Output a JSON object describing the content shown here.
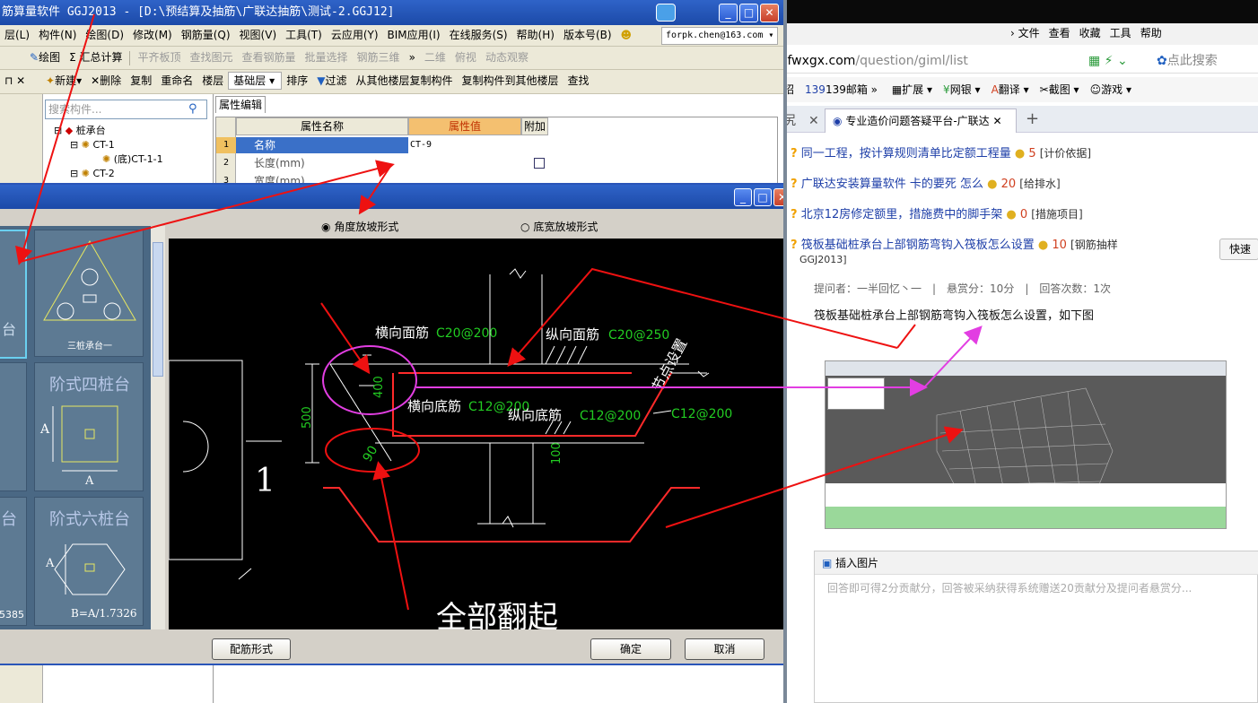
{
  "app": {
    "title": "筋算量软件 GGJ2013 - [D:\\预结算及抽筋\\广联达抽筋\\测试-2.GGJ12]",
    "menu": [
      "层(L)",
      "构件(N)",
      "绘图(D)",
      "修改(M)",
      "钢筋量(Q)",
      "视图(V)",
      "工具(T)",
      "云应用(Y)",
      "BIM应用(I)",
      "在线服务(S)",
      "帮助(H)",
      "版本号(B)"
    ],
    "account": "forpk.chen@163.com",
    "toolbar1": [
      "绘图",
      "Σ 汇总计算",
      "平齐板顶",
      "查找图元",
      "查看钢筋量",
      "批量选择",
      "钢筋三维",
      "二维",
      "俯视",
      "动态观察"
    ],
    "toolbar2": {
      "new": "新建",
      "delete": "删除",
      "copy": "复制",
      "rename": "重命名",
      "floor_label": "楼层",
      "floor_value": "基础层",
      "sort": "排序",
      "filter": "过滤",
      "copy_from": "从其他楼层复制构件",
      "copy_to": "复制构件到其他楼层",
      "find": "查找"
    },
    "search_placeholder": "搜索构件...",
    "tree": [
      "桩承台",
      "CT-1",
      "(底)CT-1-1",
      "CT-2"
    ],
    "prop_tab": "属性编辑",
    "prop_headers": [
      "属性名称",
      "属性值",
      "附加"
    ],
    "prop_rows": [
      {
        "no": "1",
        "name": "名称",
        "value": "CT-9"
      },
      {
        "no": "2",
        "name": "长度(mm)",
        "value": ""
      },
      {
        "no": "3",
        "name": "宽度(mm)",
        "value": ""
      }
    ]
  },
  "dialog": {
    "radio_angle": "角度放坡形式",
    "radio_width": "底宽放坡形式",
    "tiles": [
      "三桩承台一",
      "阶式四桩台",
      "阶式六桩台"
    ],
    "tile_texts": {
      "a": "A",
      "b": "B=A/1.7326",
      "left_partial_1": "台",
      "left_partial_2": "台",
      "left_partial_num": "5385"
    },
    "buttons": {
      "rebar_form": "配筋形式",
      "ok": "确定",
      "cancel": "取消"
    },
    "drawing": {
      "cross_top": "横向面筋",
      "cross_top_val": "C20@200",
      "long_top": "纵向面筋",
      "long_top_val": "C20@250",
      "cross_bottom": "横向底筋",
      "cross_bottom_val": "C12@200",
      "long_bottom": "纵向底筋",
      "long_bottom_val": "C12@200",
      "right_val": "C12@200",
      "node": "节点设置",
      "dim_400": "400",
      "dim_500": "500",
      "dim_100": "100",
      "angle_90": "90",
      "one": "1",
      "caption": "全部翻起"
    }
  },
  "browser": {
    "menu": [
      "文件",
      "查看",
      "收藏",
      "工具",
      "帮助"
    ],
    "url_host": ".fwxgx.com",
    "url_path": "/question/giml/list",
    "search_placeholder": "点此搜索",
    "favbar": [
      "招",
      "139邮箱",
      "扩展",
      "网银",
      "翻译",
      "截图",
      "游戏"
    ],
    "tab_title": "专业造价问题答疑平台-广联达",
    "questions": [
      {
        "title": "同一工程，按计算规则清单比定额工程量",
        "score": "5",
        "cat": "[计价依据]"
      },
      {
        "title": "广联达安装算量软件 卡的要死 怎么",
        "score": "20",
        "cat": "[给排水]"
      },
      {
        "title": "北京12房修定额里，措施费中的脚手架",
        "score": "0",
        "cat": "[措施项目]"
      },
      {
        "title": "筏板基础桩承台上部钢筋弯钩入筏板怎么设置",
        "score": "10",
        "cat": "[钢筋抽样",
        "cat2": "GGJ2013]"
      }
    ],
    "quick": "快速",
    "meta": "提问者：一半回忆丶一　|　悬赏分：10分　|　回答次数：1次",
    "body": "筏板基础桩承台上部钢筋弯钩入筏板怎么设置，如下图",
    "insert_image": "插入图片",
    "answer_placeholder": "回答即可得2分贡献分，回答被采纳获得系统赠送20贡献分及提问者悬赏分..."
  },
  "colors": {
    "title_blue": "#1c4aa8",
    "canvas": "#000000",
    "rebar_red": "#ff2a2a",
    "dim_green": "#22cc22",
    "annot_red": "#ee1111",
    "annot_magenta": "#e23ee2",
    "tile": "#5d7a93",
    "link": "#1e3fa8"
  }
}
